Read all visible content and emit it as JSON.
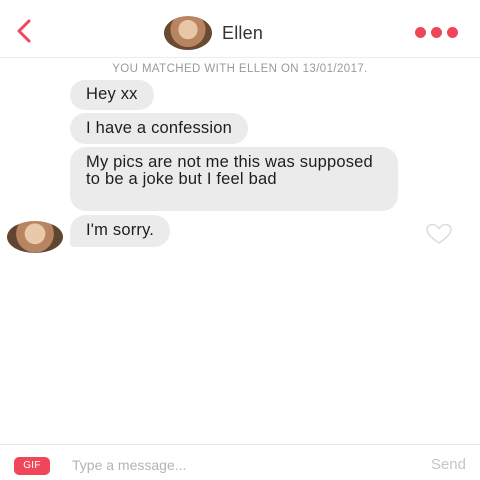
{
  "header": {
    "title": "Ellen",
    "back_icon": "chevron-left-icon",
    "more_icon": "more-dots-icon",
    "accent_color": "#f0465a"
  },
  "match_notice": "YOU MATCHED WITH ELLEN ON 13/01/2017.",
  "messages": [
    {
      "text": "Hey xx"
    },
    {
      "text": "I have a confession"
    },
    {
      "text": "My pics are not me this was supposed to be a joke but I feel bad"
    },
    {
      "text": "I'm sorry."
    }
  ],
  "composer": {
    "gif_label": "GIF",
    "placeholder": "Type a message...",
    "send_label": "Send"
  }
}
